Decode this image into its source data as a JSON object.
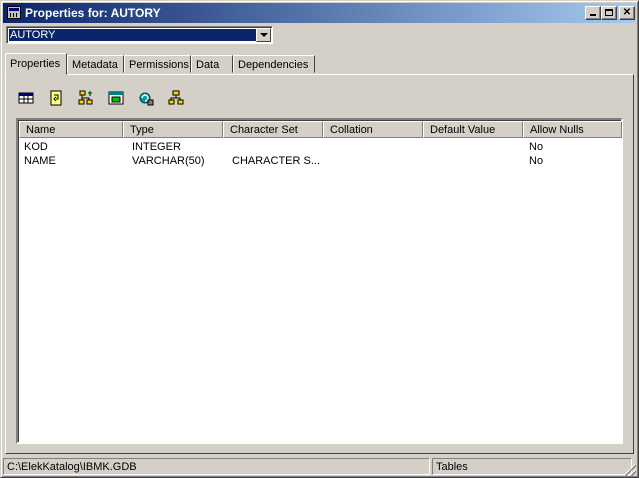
{
  "window": {
    "title": "Properties for: AUTORY"
  },
  "object_selector": {
    "value": "AUTORY"
  },
  "tabs": [
    {
      "label": "Properties",
      "active": true
    },
    {
      "label": "Metadata",
      "active": false
    },
    {
      "label": "Permissions",
      "active": false
    },
    {
      "label": "Data",
      "active": false
    },
    {
      "label": "Dependencies",
      "active": false
    }
  ],
  "toolbar": {
    "buttons": [
      {
        "icon": "table-properties-icon"
      },
      {
        "icon": "new-document-icon"
      },
      {
        "icon": "add-field-icon"
      },
      {
        "icon": "edit-field-icon"
      },
      {
        "icon": "refresh-icon"
      },
      {
        "icon": "hierarchy-icon"
      }
    ]
  },
  "grid": {
    "columns": [
      "Name",
      "Type",
      "Character Set",
      "Collation",
      "Default Value",
      "Allow Nulls"
    ],
    "rows": [
      {
        "name": "KOD",
        "type": "INTEGER",
        "charset": "",
        "collation": "",
        "default": "",
        "nulls": "No"
      },
      {
        "name": "NAME",
        "type": "VARCHAR(50)",
        "charset": "CHARACTER S...",
        "collation": "",
        "default": "",
        "nulls": "No"
      }
    ]
  },
  "status": {
    "path": "C:\\ElekKatalog\\IBMK.GDB",
    "section": "Tables"
  },
  "colors": {
    "title_start": "#0a246a",
    "title_end": "#a6caf0",
    "face": "#d4d0c8"
  }
}
